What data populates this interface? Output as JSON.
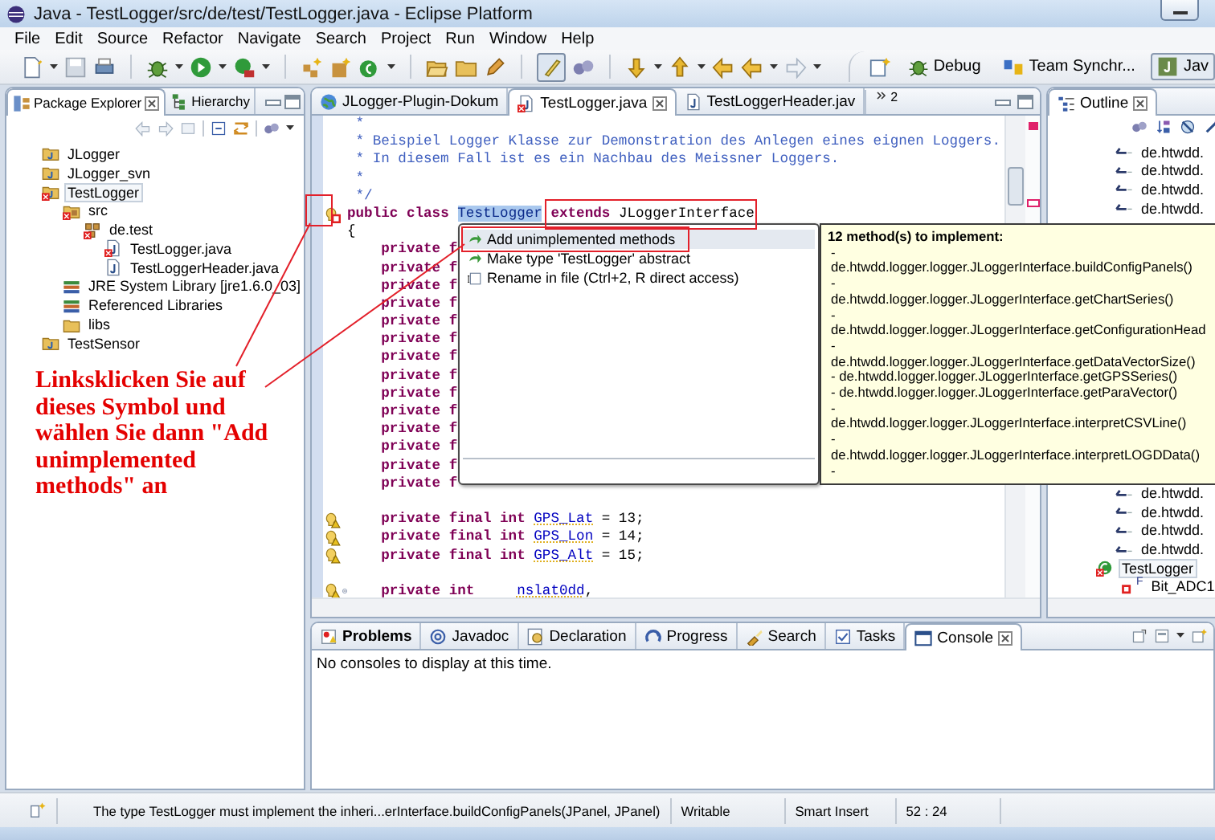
{
  "window": {
    "title": "Java - TestLogger/src/de/test/TestLogger.java - Eclipse Platform"
  },
  "menu": [
    "File",
    "Edit",
    "Source",
    "Refactor",
    "Navigate",
    "Search",
    "Project",
    "Run",
    "Window",
    "Help"
  ],
  "toolbar": {
    "highlight_toggle": {
      "pressed": true
    }
  },
  "perspectives": [
    {
      "label": "Debug",
      "kind": "debug",
      "selected": false
    },
    {
      "label": "Team Synchr...",
      "kind": "team",
      "selected": false
    },
    {
      "label": "Jav",
      "kind": "java",
      "selected": true
    }
  ],
  "package_explorer": {
    "tabs": [
      {
        "label": "Package Explorer",
        "kind": "packages",
        "selected": true
      },
      {
        "label": "Hierarchy",
        "kind": "hierarchy",
        "selected": false
      }
    ],
    "tree": [
      {
        "label": "JLogger",
        "kind": "project",
        "error": false,
        "selected": false
      },
      {
        "label": "JLogger_svn",
        "kind": "project",
        "error": false,
        "selected": false
      },
      {
        "label": "TestLogger",
        "kind": "project",
        "error": true,
        "selected": true,
        "children": [
          {
            "label": "src",
            "kind": "source-folder",
            "error": true,
            "selected": false,
            "children": [
              {
                "label": "de.test",
                "kind": "package",
                "error": true,
                "selected": false,
                "children": [
                  {
                    "label": "TestLogger.java",
                    "kind": "java-file",
                    "error": true,
                    "selected": false
                  },
                  {
                    "label": "TestLoggerHeader.java",
                    "kind": "java-file",
                    "error": false,
                    "selected": false
                  }
                ]
              }
            ]
          },
          {
            "label": "JRE System Library [jre1.6.0_03]",
            "kind": "library",
            "error": false,
            "selected": false
          },
          {
            "label": "Referenced Libraries",
            "kind": "library",
            "error": false,
            "selected": false
          },
          {
            "label": "libs",
            "kind": "folder",
            "error": false,
            "selected": false
          }
        ]
      },
      {
        "label": "TestSensor",
        "kind": "project",
        "error": false,
        "selected": false
      }
    ]
  },
  "editor": {
    "tabs": [
      {
        "label": "JLogger-Plugin-Dokum",
        "kind": "web",
        "selected": false
      },
      {
        "label": "TestLogger.java",
        "kind": "java-error",
        "selected": true
      },
      {
        "label": "TestLoggerHeader.jav",
        "kind": "java",
        "selected": false
      }
    ],
    "overflow_count": "2",
    "lines": [
      {
        "kind": "comment",
        "tokens": [
          {
            "kind": "comment",
            "text": "*"
          }
        ]
      },
      {
        "kind": "comment",
        "tokens": [
          {
            "kind": "comment",
            "text": "* Beispiel Logger Klasse zur Demonstration des Anlegen eines eignen Loggers."
          }
        ]
      },
      {
        "kind": "comment",
        "tokens": [
          {
            "kind": "comment",
            "text": "* In diesem Fall ist es ein Nachbau des Meissner Loggers."
          }
        ]
      },
      {
        "kind": "comment",
        "tokens": [
          {
            "kind": "comment",
            "text": "*"
          }
        ]
      },
      {
        "kind": "comment",
        "tokens": [
          {
            "kind": "comment",
            "text": "*/"
          }
        ]
      },
      {
        "kind": "code",
        "quick_fix": true,
        "tokens": [
          {
            "kind": "keyword",
            "text": "public class "
          },
          {
            "kind": "selection",
            "text": "TestLogger"
          },
          {
            "kind": "keyword",
            "text": " extends"
          },
          {
            "kind": "plain",
            "text": " JLoggerInterface"
          }
        ]
      },
      {
        "kind": "code",
        "tokens": [
          {
            "kind": "plain",
            "text": "{"
          }
        ]
      },
      {
        "kind": "member",
        "tokens": [
          {
            "kind": "keyword",
            "text": "private f"
          }
        ]
      },
      {
        "kind": "member",
        "tokens": [
          {
            "kind": "keyword",
            "text": "private f"
          }
        ]
      },
      {
        "kind": "member",
        "tokens": [
          {
            "kind": "keyword",
            "text": "private f"
          }
        ]
      },
      {
        "kind": "member",
        "tokens": [
          {
            "kind": "keyword",
            "text": "private f"
          }
        ]
      },
      {
        "kind": "member",
        "tokens": [
          {
            "kind": "keyword",
            "text": "private f"
          }
        ]
      },
      {
        "kind": "member",
        "tokens": [
          {
            "kind": "keyword",
            "text": "private f"
          }
        ]
      },
      {
        "kind": "member",
        "tokens": [
          {
            "kind": "keyword",
            "text": "private f"
          }
        ]
      },
      {
        "kind": "member",
        "tokens": [
          {
            "kind": "keyword",
            "text": "private f"
          }
        ]
      },
      {
        "kind": "member",
        "tokens": [
          {
            "kind": "keyword",
            "text": "private f"
          }
        ]
      },
      {
        "kind": "member",
        "tokens": [
          {
            "kind": "keyword",
            "text": "private f"
          }
        ]
      },
      {
        "kind": "member",
        "tokens": [
          {
            "kind": "keyword",
            "text": "private f"
          }
        ]
      },
      {
        "kind": "member",
        "tokens": [
          {
            "kind": "keyword",
            "text": "private f"
          }
        ]
      },
      {
        "kind": "member",
        "tokens": [
          {
            "kind": "keyword",
            "text": "private f"
          }
        ]
      },
      {
        "kind": "member",
        "tokens": [
          {
            "kind": "keyword",
            "text": "private f"
          }
        ]
      },
      {
        "kind": "blank"
      },
      {
        "kind": "member",
        "warning": true,
        "tokens": [
          {
            "kind": "keyword",
            "text": "private final int "
          },
          {
            "kind": "field",
            "text": "GPS_Lat"
          },
          {
            "kind": "plain",
            "text": " = 13;"
          }
        ]
      },
      {
        "kind": "member",
        "warning": true,
        "tokens": [
          {
            "kind": "keyword",
            "text": "private final int "
          },
          {
            "kind": "field",
            "text": "GPS_Lon"
          },
          {
            "kind": "plain",
            "text": " = 14;"
          }
        ]
      },
      {
        "kind": "member",
        "warning": true,
        "tokens": [
          {
            "kind": "keyword",
            "text": "private final int "
          },
          {
            "kind": "field",
            "text": "GPS_Alt"
          },
          {
            "kind": "plain",
            "text": " = 15;"
          }
        ]
      },
      {
        "kind": "blank"
      },
      {
        "kind": "member",
        "warning": true,
        "folding": true,
        "tokens": [
          {
            "kind": "keyword",
            "text": "private int     "
          },
          {
            "kind": "field",
            "text": "nslat0dd"
          },
          {
            "kind": "plain",
            "text": ","
          }
        ]
      }
    ]
  },
  "quick_fix": {
    "proposals": [
      {
        "label": "Add unimplemented methods",
        "kind": "change",
        "selected": true
      },
      {
        "label": "Make type 'TestLogger' abstract",
        "kind": "change",
        "selected": false
      },
      {
        "label": "Rename in file (Ctrl+2, R direct access)",
        "kind": "rename",
        "selected": false
      }
    ]
  },
  "hover": {
    "title": "12 method(s) to implement:",
    "lines": [
      "-",
      "de.htwdd.logger.logger.JLoggerInterface.buildConfigPanels()",
      "-",
      "de.htwdd.logger.logger.JLoggerInterface.getChartSeries()",
      "-",
      "de.htwdd.logger.logger.JLoggerInterface.getConfigurationHead",
      "-",
      "de.htwdd.logger.logger.JLoggerInterface.getDataVectorSize()",
      "- de.htwdd.logger.logger.JLoggerInterface.getGPSSeries()",
      "- de.htwdd.logger.logger.JLoggerInterface.getParaVector()",
      "-",
      "de.htwdd.logger.logger.JLoggerInterface.interpretCSVLine()",
      "-",
      "de.htwdd.logger.logger.JLoggerInterface.interpretLOGDData()",
      "-"
    ]
  },
  "outline": {
    "tabs": [
      {
        "label": "Outline",
        "kind": "outline",
        "selected": true
      }
    ],
    "items_top": [
      {
        "label": "de.htwdd.",
        "kind": "import",
        "selected": false
      },
      {
        "label": "de.htwdd.",
        "kind": "import",
        "selected": false
      },
      {
        "label": "de.htwdd.",
        "kind": "import",
        "selected": false
      },
      {
        "label": "de.htwdd.",
        "kind": "import",
        "selected": false
      }
    ],
    "items_bottom": [
      {
        "label": "de.htwdd.",
        "kind": "import",
        "selected": false
      },
      {
        "label": "de.htwdd.",
        "kind": "import",
        "selected": false
      },
      {
        "label": "de.htwdd.",
        "kind": "import",
        "selected": false
      },
      {
        "label": "de.htwdd.",
        "kind": "import",
        "selected": false
      },
      {
        "label": "TestLogger",
        "kind": "class",
        "selected": true,
        "children": [
          {
            "label": "Bit_ADC1",
            "kind": "field",
            "modifier": "F",
            "selected": false
          }
        ]
      }
    ]
  },
  "bottom_panel": {
    "tabs": [
      {
        "label": "Problems",
        "kind": "problems",
        "selected": false,
        "emphasized": true
      },
      {
        "label": "Javadoc",
        "kind": "javadoc",
        "selected": false,
        "emphasized": false
      },
      {
        "label": "Declaration",
        "kind": "declaration",
        "selected": false,
        "emphasized": false
      },
      {
        "label": "Progress",
        "kind": "progress",
        "selected": false,
        "emphasized": false
      },
      {
        "label": "Search",
        "kind": "search",
        "selected": false,
        "emphasized": false
      },
      {
        "label": "Tasks",
        "kind": "tasks",
        "selected": false,
        "emphasized": false
      },
      {
        "label": "Console",
        "kind": "console",
        "selected": true,
        "emphasized": false
      }
    ],
    "message": "No consoles to display at this time."
  },
  "annotation": {
    "text": "Linksklicken Sie auf dieses Symbol und wählen Sie dann \"Add unimplemented methods\" an"
  },
  "status_bar": {
    "message": "The type TestLogger must implement the inheri...erInterface.buildConfigPanels(JPanel, JPanel)",
    "mode": "Writable",
    "insert_mode": "Smart Insert",
    "position": "52 : 24"
  }
}
